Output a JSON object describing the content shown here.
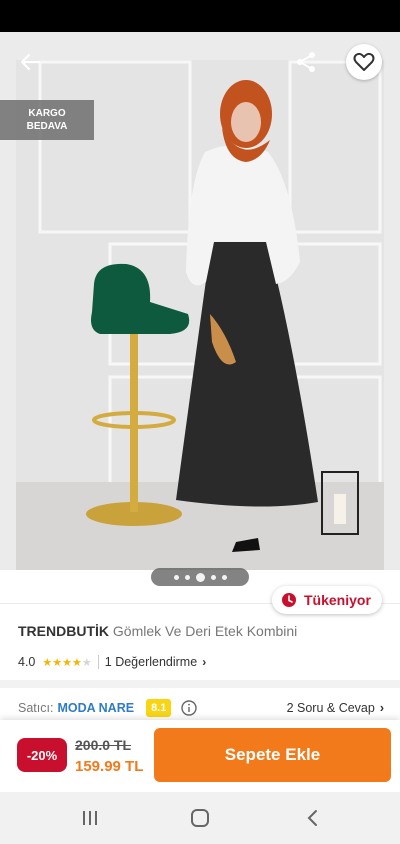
{
  "product": {
    "cargo_badge_line1": "KARGO",
    "cargo_badge_line2": "BEDAVA",
    "stock_status": "Tükeniyor",
    "brand": "TRENDBUTİK",
    "name": "Gömlek Ve Deri Etek Kombini",
    "rating": "4.0",
    "stars_filled": 4,
    "reviews": "1 Değerlendirme",
    "image_pager": {
      "count": 5,
      "active_index": 2
    }
  },
  "seller": {
    "label": "Satıcı:",
    "name": "MODA NARE",
    "score": "8.1",
    "qa": "2 Soru & Cevap"
  },
  "pricing": {
    "discount": "-20%",
    "old_price": "200.0 TL",
    "new_price": "159.99 TL",
    "cart_button": "Sepete Ekle"
  },
  "icons": {
    "back": "arrow-left-icon",
    "share": "share-icon",
    "favorite": "heart-outline-icon",
    "stock": "clock-icon",
    "info": "info-circle-icon",
    "nav_recent": "recent-apps-icon",
    "nav_home": "home-icon",
    "nav_back": "nav-back-icon"
  },
  "colors": {
    "brand_orange": "#f27a1a",
    "discount_red": "#c8102e",
    "seller_blue": "#2e7cc8",
    "score_yellow": "#f8d512",
    "star_yellow": "#f7b500"
  }
}
